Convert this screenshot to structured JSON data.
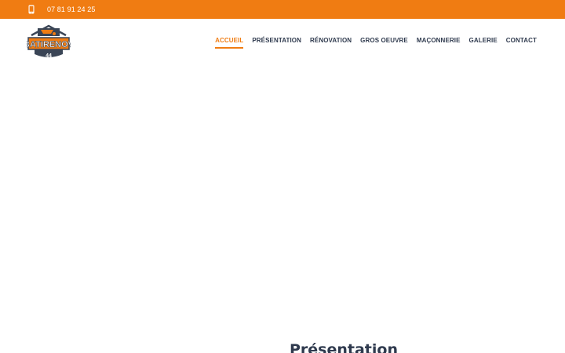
{
  "topbar": {
    "phone_icon": "mobile-phone-icon",
    "phone_number": "07 81 91 24 25",
    "background_color": "#f07c12"
  },
  "header": {
    "logo": {
      "text": "BATIRENOV",
      "number": "44"
    },
    "nav": [
      {
        "label": "ACCUEIL",
        "active": true
      },
      {
        "label": "PRÉSENTATION",
        "active": false
      },
      {
        "label": "RÉNOVATION",
        "active": false
      },
      {
        "label": "GROS OEUVRE",
        "active": false
      },
      {
        "label": "MAÇONNERIE",
        "active": false
      },
      {
        "label": "GALERIE",
        "active": false
      },
      {
        "label": "CONTACT",
        "active": false
      }
    ],
    "accent_color": "#f07c12",
    "text_color": "#2f3a4e"
  },
  "main": {
    "section_title": "Présentation"
  }
}
